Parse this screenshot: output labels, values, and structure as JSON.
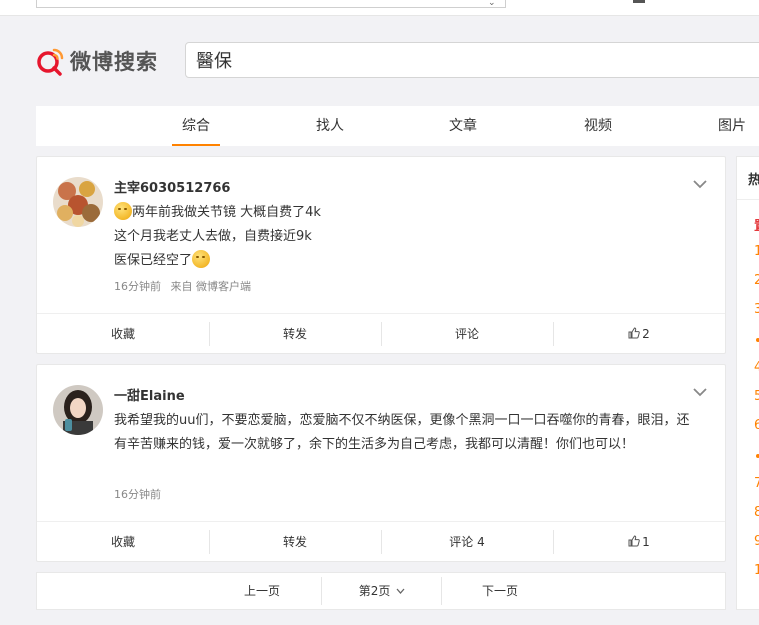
{
  "search": {
    "query": "醫保"
  },
  "logo": {
    "text": "微博搜索"
  },
  "tabs": [
    "综合",
    "找人",
    "文章",
    "视频",
    "图片"
  ],
  "posts": [
    {
      "username": "主宰6030512766",
      "lines": [
        "两年前我做关节镜 大概自费了4k",
        "这个月我老丈人去做，自费接近9k",
        "医保已经空了"
      ],
      "time": "16分钟前",
      "source": "来自 微博客户端",
      "actions": {
        "collect": "收藏",
        "repost": "转发",
        "comment": "评论",
        "like": "2"
      }
    },
    {
      "username": "一甜Elaine",
      "lines": [
        "我希望我的uu们，不要恋爱脑，恋爱脑不仅不纳医保，更像个黑洞一口一口吞噬你的青春，眼泪，还有辛苦赚来的钱，爱一次就够了，余下的生活多为自己考虑，我都可以清醒！你们也可以！"
      ],
      "time": "16分钟前",
      "actions": {
        "collect": "收藏",
        "repost": "转发",
        "comment": "评论 4",
        "like": "1"
      }
    }
  ],
  "pager": {
    "prev": "上一页",
    "current": "第2页",
    "next": "下一页"
  },
  "sidebar": {
    "title": "热",
    "ranks": [
      "置",
      "1",
      "2",
      "3",
      "•",
      "4",
      "5",
      "6",
      "•",
      "7",
      "8",
      "9",
      "1"
    ]
  }
}
